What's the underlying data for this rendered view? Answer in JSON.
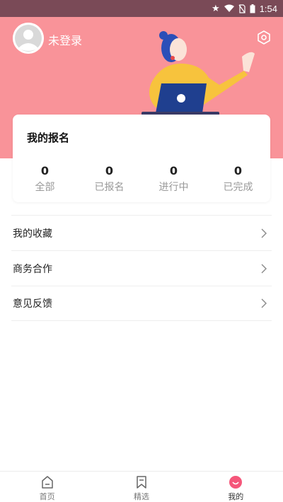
{
  "status_bar": {
    "time": "1:54",
    "icons": [
      "star-icon",
      "wifi-icon",
      "no-sim-icon",
      "battery-icon"
    ]
  },
  "profile": {
    "username": "未登录",
    "icons": [
      "avatar-icon",
      "settings-icon"
    ]
  },
  "registration_card": {
    "title": "我的报名",
    "stats": [
      {
        "count": "0",
        "label": "全部"
      },
      {
        "count": "0",
        "label": "已报名"
      },
      {
        "count": "0",
        "label": "进行中"
      },
      {
        "count": "0",
        "label": "已完成"
      }
    ]
  },
  "menu": {
    "items": [
      {
        "label": "我的收藏",
        "icon": "chevron-right-icon"
      },
      {
        "label": "商务合作",
        "icon": "chevron-right-icon"
      },
      {
        "label": "意见反馈",
        "icon": "chevron-right-icon"
      }
    ]
  },
  "tab_bar": {
    "tabs": [
      {
        "label": "首页",
        "icon": "home-icon"
      },
      {
        "label": "精选",
        "icon": "bookmark-icon"
      },
      {
        "label": "我的",
        "icon": "smile-icon",
        "active": true
      }
    ]
  },
  "colors": {
    "header_bg": "#f99399",
    "status_bar_bg": "#7a4a57",
    "accent": "#f5567a"
  }
}
